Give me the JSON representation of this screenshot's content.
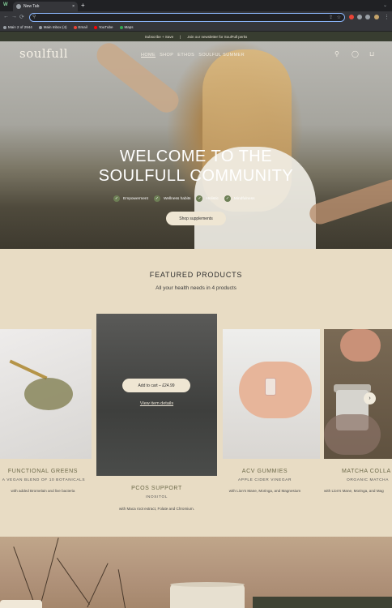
{
  "browser": {
    "tab_title": "New Tab",
    "new_tab_symbol": "+",
    "close_symbol": "×",
    "workspace_symbol": "W",
    "address_value": "",
    "bookmarks": [
      {
        "label": "Main 2 of 2944",
        "color": "#9aa0a6"
      },
      {
        "label": "Main Inbox (4)",
        "color": "#9aa0a6"
      },
      {
        "label": "Email",
        "color": "#ea4335"
      },
      {
        "label": "YouTube",
        "color": "#ff0000"
      },
      {
        "label": "Maps",
        "color": "#34a853"
      }
    ]
  },
  "announcement": {
    "left": "Subscribe + Save",
    "separator": "|",
    "right": "Join our newsletter for SoulFull perks"
  },
  "header": {
    "logo": "soulfull",
    "nav": [
      {
        "label": "HOME",
        "active": true
      },
      {
        "label": "SHOP",
        "active": false
      },
      {
        "label": "ETHOS",
        "active": false
      },
      {
        "label": "SOULFUL SUMMER",
        "active": false
      }
    ]
  },
  "hero": {
    "title_line1": "WELCOME TO THE",
    "title_line2": "SOULFULL COMMUNITY",
    "checks": [
      "Empowerment",
      "Wellness habits",
      "Holistic",
      "Mindfulness"
    ],
    "cta": "Shop supplements"
  },
  "featured": {
    "title": "FEATURED PRODUCTS",
    "subtitle": "All your health needs in 4 products",
    "products": [
      {
        "name": "FUNCTIONAL GREENS",
        "sub": "A VEGAN BLEND OF 10 BOTANICALS",
        "desc": "with added Bromelain and live bacteria"
      },
      {
        "name": "PCOS SUPPORT",
        "sub": "INOSITOL",
        "desc": "with Maca root extract, Folate and Chromium.",
        "add_to_cart": "Add to cart – £24.99",
        "view_details": "View item details"
      },
      {
        "name": "ACV GUMMIES",
        "sub": "APPLE CIDER VINEGAR",
        "desc": "with Lion's Mane, Moringa, and Magnesium"
      },
      {
        "name": "MATCHA COLLA",
        "sub": "ORGANIC MATCHA",
        "desc": "with Lion's Mane, Moringa, and Mag"
      }
    ]
  },
  "colors": {
    "page_bg": "#e8dcc4",
    "announcement_bg": "#383d30",
    "accent_olive": "#6d7f55",
    "button_bg": "#efe6d3"
  }
}
